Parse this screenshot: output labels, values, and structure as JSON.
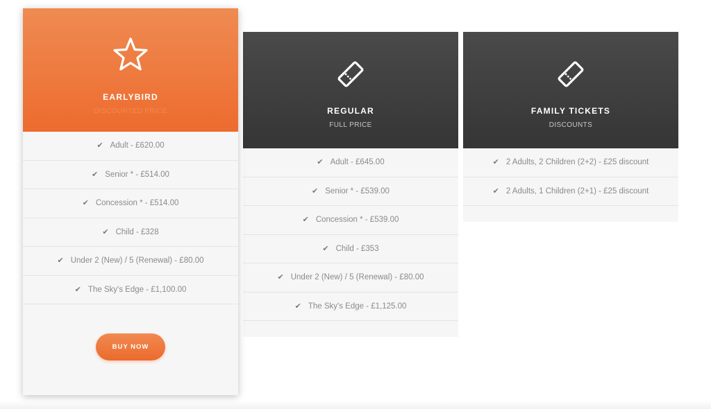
{
  "plans": [
    {
      "name": "EARLYBIRD",
      "subtitle": "DISCOUNTED PRICE",
      "icon": "star-icon",
      "features": [
        "Adult - £620.00",
        "Senior * - £514.00",
        "Concession * - £514.00",
        "Child - £328",
        "Under 2 (New) / 5 (Renewal) - £80.00",
        "The Sky's Edge - £1,100.00"
      ],
      "button_label": "BUY NOW"
    },
    {
      "name": "REGULAR",
      "subtitle": "FULL PRICE",
      "icon": "ticket-icon",
      "features": [
        "Adult - £645.00",
        "Senior * - £539.00",
        "Concession * - £539.00",
        "Child - £353",
        "Under 2 (New) / 5 (Renewal) - £80.00",
        "The Sky's Edge - £1,125.00"
      ]
    },
    {
      "name": "FAMILY TICKETS",
      "subtitle": "DISCOUNTS",
      "icon": "ticket-icon",
      "features": [
        "2 Adults, 2 Children (2+2) - £25 discount",
        "2 Adults, 1 Children (2+1) - £25 discount"
      ]
    }
  ],
  "colors": {
    "accent_orange": "#ed6b2e",
    "dark_header": "#3f3f3f",
    "card_bg": "#f6f6f6",
    "feature_text": "#8a8a8a"
  }
}
